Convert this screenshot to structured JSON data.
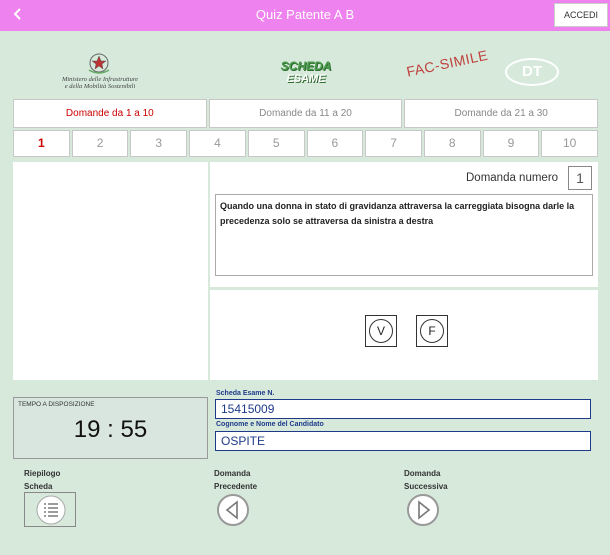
{
  "app": {
    "title": "Quiz Patente A B",
    "login_label": "ACCEDI",
    "back_icon": "chevron-left-icon"
  },
  "header": {
    "ministry_line1": "Ministero delle Infrastrutture",
    "ministry_line2": "e della Mobilità Sostenibili",
    "scheda_line1": "SCHEDA",
    "scheda_line2": "ESAME",
    "facsimile": "FAC-SIMILE",
    "dt_logo": "DT"
  },
  "groups": [
    "Domande da 1 a 10",
    "Domande da 11 a 20",
    "Domande da 21 a 30"
  ],
  "question_numbers": [
    "1",
    "2",
    "3",
    "4",
    "5",
    "6",
    "7",
    "8",
    "9",
    "10"
  ],
  "question": {
    "label": "Domanda numero",
    "number": "1",
    "text": "Quando una donna in stato di gravidanza attraversa la carreggiata bisogna darle la precedenza solo se attraversa da sinistra a destra"
  },
  "answers": {
    "true_label": "V",
    "false_label": "F"
  },
  "timer": {
    "label": "TEMPO A DISPOSIZIONE",
    "value": "19 : 55"
  },
  "exam": {
    "scheda_label": "Scheda Esame N.",
    "scheda_value": "15415009",
    "candidate_label": "Cognome e Nome del Candidato",
    "candidate_value": "OSPITE"
  },
  "nav": {
    "summary_line1": "Riepilogo",
    "summary_line2": "Scheda",
    "prev_line1": "Domanda",
    "prev_line2": "Precedente",
    "next_line1": "Domanda",
    "next_line2": "Successiva"
  },
  "colors": {
    "topbar": "#ee82ee",
    "background": "#d6e9db",
    "active": "#cc0000",
    "field": "#1f3a8a"
  }
}
